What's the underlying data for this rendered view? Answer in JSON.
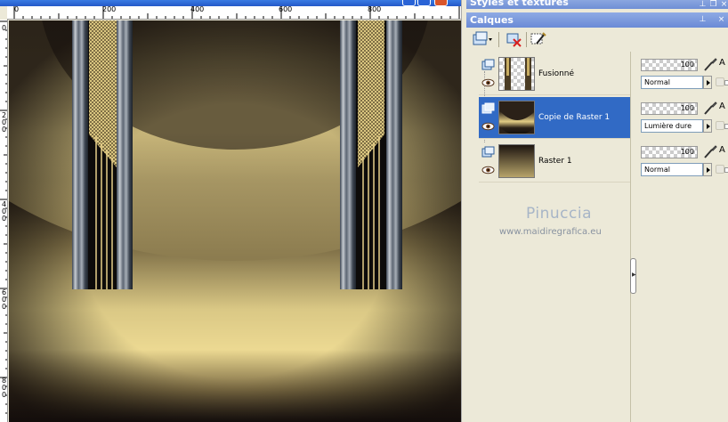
{
  "image_window": {
    "ruler_h_labels": [
      "0",
      "200",
      "400",
      "600",
      "800"
    ],
    "ruler_v_labels": [
      "0",
      "2\n0\n0",
      "4\n0\n0",
      "6\n0\n0",
      "8\n0\n0"
    ]
  },
  "styles_panel": {
    "title": "Styles et textures"
  },
  "layers_panel": {
    "title": "Calques",
    "layers": [
      {
        "name": "Fusionné",
        "opacity": 100,
        "blend_mode": "Normal",
        "selected": false
      },
      {
        "name": "Copie de Raster 1",
        "opacity": 100,
        "blend_mode": "Lumière dure",
        "selected": true
      },
      {
        "name": "Raster 1",
        "opacity": 100,
        "blend_mode": "Normal",
        "selected": false
      }
    ],
    "edge_letter": "A",
    "watermark": {
      "name": "Pinuccia",
      "url": "www.maidiregrafica.eu"
    }
  },
  "colors": {
    "title_bar": "#6f8fd6",
    "selection": "#316ac5",
    "panel_bg": "#ece9d8",
    "canvas_gold": "#e8d690",
    "canvas_dark": "#1a1210"
  },
  "icons": {
    "new_layer": "new-layer-icon",
    "delete_layer": "delete-layer-icon",
    "layer_properties": "layer-properties-icon",
    "visibility": "eye-icon",
    "brush": "brush-icon"
  }
}
